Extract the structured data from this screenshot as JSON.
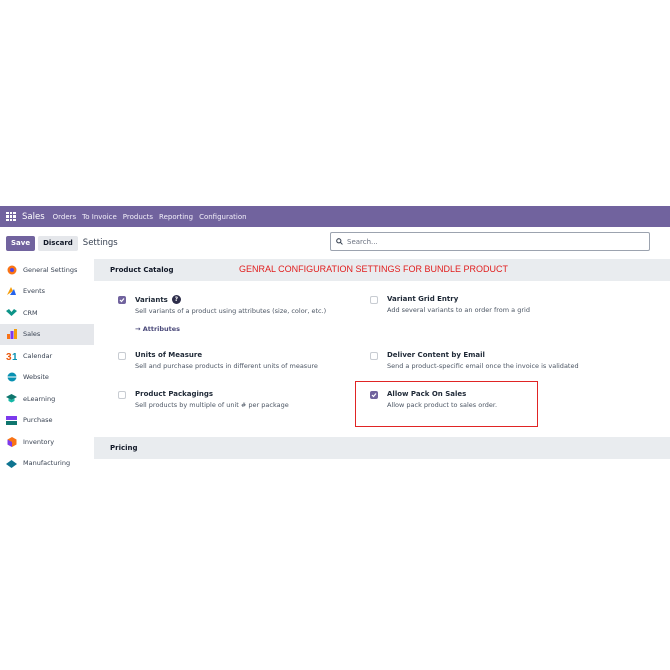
{
  "topbar": {
    "app_name": "Sales",
    "menu": [
      "Orders",
      "To Invoice",
      "Products",
      "Reporting",
      "Configuration"
    ]
  },
  "control": {
    "save_label": "Save",
    "discard_label": "Discard",
    "title": "Settings",
    "search_placeholder": "Search..."
  },
  "sidebar": {
    "items": [
      {
        "label": "General Settings",
        "icon": "general-settings-icon",
        "color": "#f97316"
      },
      {
        "label": "Events",
        "icon": "events-icon",
        "color": "#f59e0b"
      },
      {
        "label": "CRM",
        "icon": "crm-icon",
        "color": "#0d9488"
      },
      {
        "label": "Sales",
        "icon": "sales-icon",
        "color": "#f97316"
      },
      {
        "label": "Calendar",
        "icon": "calendar-icon",
        "color": "#ea580c"
      },
      {
        "label": "Website",
        "icon": "website-icon",
        "color": "#0891b2"
      },
      {
        "label": "eLearning",
        "icon": "elearning-icon",
        "color": "#0f766e"
      },
      {
        "label": "Purchase",
        "icon": "purchase-icon",
        "color": "#7c3aed"
      },
      {
        "label": "Inventory",
        "icon": "inventory-icon",
        "color": "#f97316"
      },
      {
        "label": "Manufacturing",
        "icon": "manufacturing-icon",
        "color": "#0e7490"
      }
    ]
  },
  "main": {
    "section_title": "Product Catalog",
    "banner": "GENRAL CONFIGURATION SETTINGS FOR BUNDLE PRODUCT",
    "settings": [
      {
        "title": "Variants",
        "desc": "Sell variants of a product using attributes (size, color, etc.)",
        "checked": true,
        "link": "→ Attributes"
      },
      {
        "title": "Variant Grid Entry",
        "desc": "Add several variants to an order from a grid",
        "checked": false
      },
      {
        "title": "Units of Measure",
        "desc": "Sell and purchase products in different units of measure",
        "checked": false
      },
      {
        "title": "Deliver Content by Email",
        "desc": "Send a product-specific email once the invoice is validated",
        "checked": false
      },
      {
        "title": "Product Packagings",
        "desc": "Sell products by multiple of unit # per package",
        "checked": false
      },
      {
        "title": "Allow Pack On Sales",
        "desc": "Allow pack product to sales order.",
        "checked": true
      }
    ],
    "pricing_title": "Pricing"
  },
  "colors": {
    "brand": "#71639e",
    "highlight": "#e02424"
  }
}
